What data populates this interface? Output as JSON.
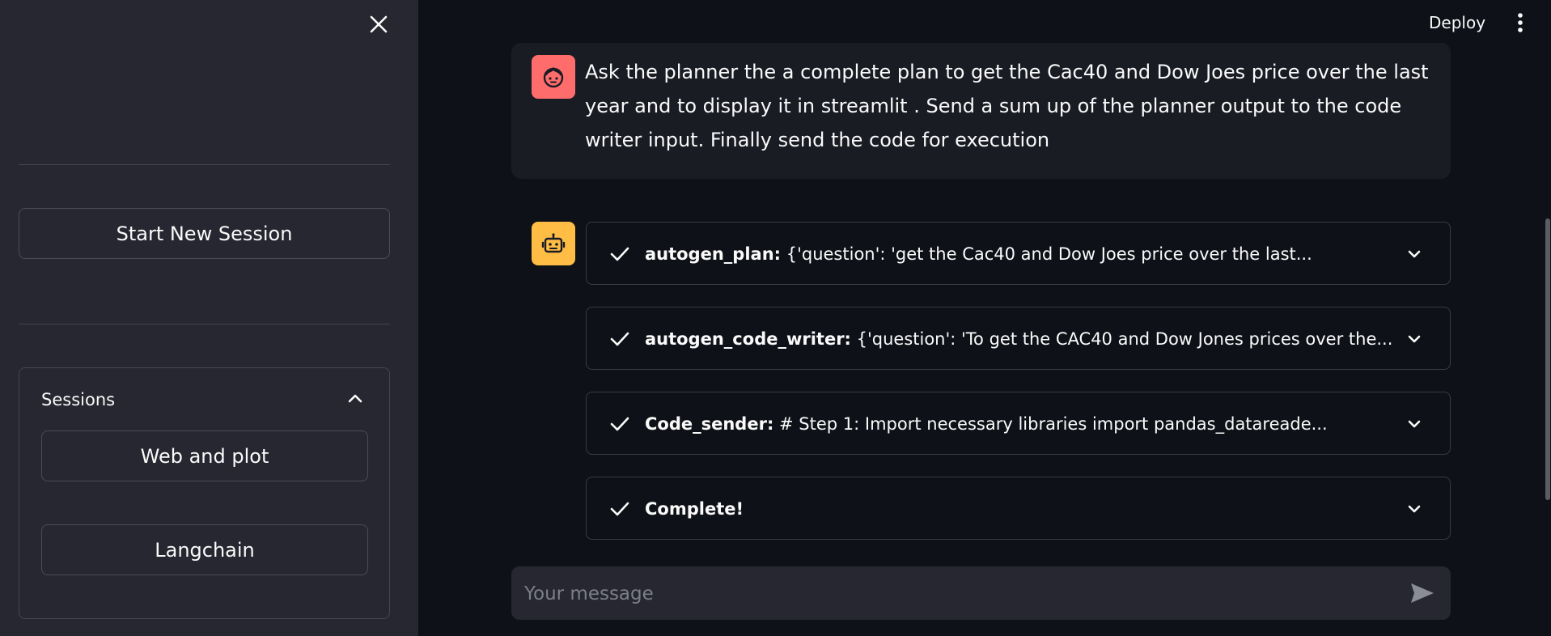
{
  "sidebar": {
    "new_session_label": "Start New Session",
    "sessions": {
      "title": "Sessions",
      "items": [
        {
          "label": "Web and plot"
        },
        {
          "label": "Langchain"
        }
      ]
    }
  },
  "header": {
    "deploy_label": "Deploy"
  },
  "chat": {
    "user_message": "Ask the planner the a complete plan to get the Cac40 and Dow Joes price over the last year and to display it in streamlit . Send a sum up of the planner output to the code writer input. Finally send the code for execution",
    "steps": [
      {
        "name": "autogen_plan:",
        "detail": " {'question': 'get the Cac40 and Dow Joes price over the last..."
      },
      {
        "name": "autogen_code_writer:",
        "detail": " {'question': 'To get the CAC40 and Dow Jones prices over the..."
      },
      {
        "name": "Code_sender:",
        "detail": " # Step 1: Import necessary libraries import pandas_datareade..."
      },
      {
        "name": "Complete!",
        "detail": ""
      }
    ],
    "input_placeholder": "Your message"
  },
  "icons": {
    "close": "close-icon",
    "user_avatar": "user-face-icon",
    "bot_avatar": "robot-icon",
    "check": "check-icon",
    "chevron": "chevron-down-icon",
    "send": "send-icon",
    "kebab": "more-vertical-icon"
  },
  "colors": {
    "user_avatar_bg": "#ff6c6c",
    "bot_avatar_bg": "#ffbd45",
    "app_bg": "#0e1117",
    "sidebar_bg": "#262730"
  }
}
